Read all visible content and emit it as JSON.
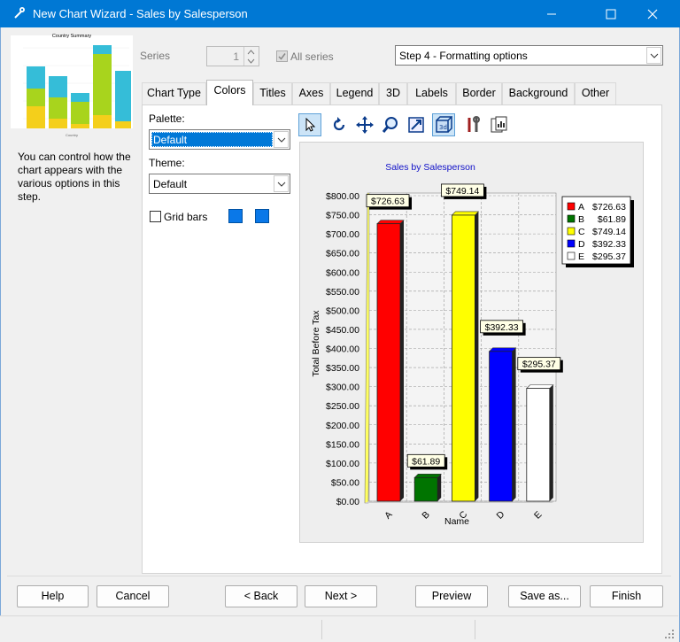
{
  "window": {
    "title": "New Chart Wizard - Sales by Salesperson"
  },
  "thumbnail": {
    "title": "Country Summary",
    "xlabel": "Country"
  },
  "description": "You can control how the chart appears with the various options in this step.",
  "series": {
    "label": "Series",
    "value": "1",
    "all_series_label": "All series",
    "all_series_checked": true
  },
  "step_combo": {
    "value": "Step 4 - Formatting options"
  },
  "tabs": [
    {
      "label": "Chart Type"
    },
    {
      "label": "Colors"
    },
    {
      "label": "Titles"
    },
    {
      "label": "Axes"
    },
    {
      "label": "Legend"
    },
    {
      "label": "3D"
    },
    {
      "label": "Labels"
    },
    {
      "label": "Border"
    },
    {
      "label": "Background"
    },
    {
      "label": "Other"
    }
  ],
  "colors_tab": {
    "palette_label": "Palette:",
    "palette_value": "Default",
    "theme_label": "Theme:",
    "theme_value": "Default",
    "grid_bars_label": "Grid bars",
    "grid_bars_checked": false,
    "swatch_color_1": "#0a78e8",
    "swatch_color_2": "#0a78e8"
  },
  "toolbar_icons": [
    "pointer-icon",
    "rotate-icon",
    "move-icon",
    "zoom-icon",
    "fit-icon",
    "3d-icon",
    "tools-icon",
    "copy-chart-icon"
  ],
  "chart_data": {
    "type": "bar",
    "title": "Sales by Salesperson",
    "xlabel": "Name",
    "ylabel": "Total Before Tax",
    "categories": [
      "A",
      "B",
      "C",
      "D",
      "E"
    ],
    "values": [
      726.63,
      61.89,
      749.14,
      392.33,
      295.37
    ],
    "value_labels": [
      "$726.63",
      "$61.89",
      "$749.14",
      "$392.33",
      "$295.37"
    ],
    "colors": [
      "#ff0000",
      "#007400",
      "#ffff00",
      "#0000ff",
      "#ffffff"
    ],
    "ylim": [
      0,
      800
    ],
    "yticks": [
      "$0.00",
      "$50.00",
      "$100.00",
      "$150.00",
      "$200.00",
      "$250.00",
      "$300.00",
      "$350.00",
      "$400.00",
      "$450.00",
      "$500.00",
      "$550.00",
      "$600.00",
      "$650.00",
      "$700.00",
      "$750.00",
      "$800.00"
    ],
    "legend": [
      {
        "key": "A",
        "value": "$726.63"
      },
      {
        "key": "B",
        "value": "$61.89"
      },
      {
        "key": "C",
        "value": "$749.14"
      },
      {
        "key": "D",
        "value": "$392.33"
      },
      {
        "key": "E",
        "value": "$295.37"
      }
    ],
    "legend_position": "top-right",
    "grid": true
  },
  "buttons": {
    "help": "Help",
    "cancel": "Cancel",
    "back": "< Back",
    "next": "Next >",
    "preview": "Preview",
    "save_as": "Save as...",
    "finish": "Finish"
  }
}
